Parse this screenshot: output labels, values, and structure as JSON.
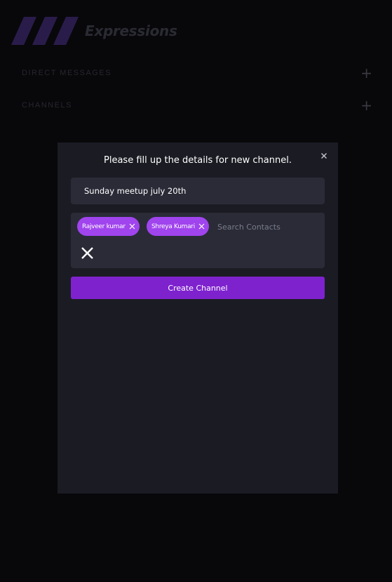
{
  "app": {
    "name": "Expressions"
  },
  "sidebar": {
    "sections": [
      {
        "title": "DIRECT MESSAGES",
        "add_symbol": "+"
      },
      {
        "title": "CHANNELS",
        "add_symbol": "+"
      }
    ]
  },
  "modal": {
    "title": "Please fill up the details for new channel.",
    "channel_name_value": "Sunday meetup july 20th",
    "selected_contacts": [
      {
        "name": "Rajveer kumar"
      },
      {
        "name": "Shreya Kumari"
      }
    ],
    "search_placeholder": "Search Contacts",
    "create_label": "Create Channel"
  },
  "colors": {
    "page_background": "#08080b",
    "modal_background": "#1b1c23",
    "input_background": "#2a2b37",
    "chip": "#a044ee",
    "accent": "#7e22ce",
    "logo_dim": "#2a1c4a"
  },
  "icons": {
    "logo": "slanted-bars-logo",
    "close": "close-icon",
    "chip_remove": "x-icon",
    "clear_all": "x-icon",
    "add": "plus-icon"
  }
}
